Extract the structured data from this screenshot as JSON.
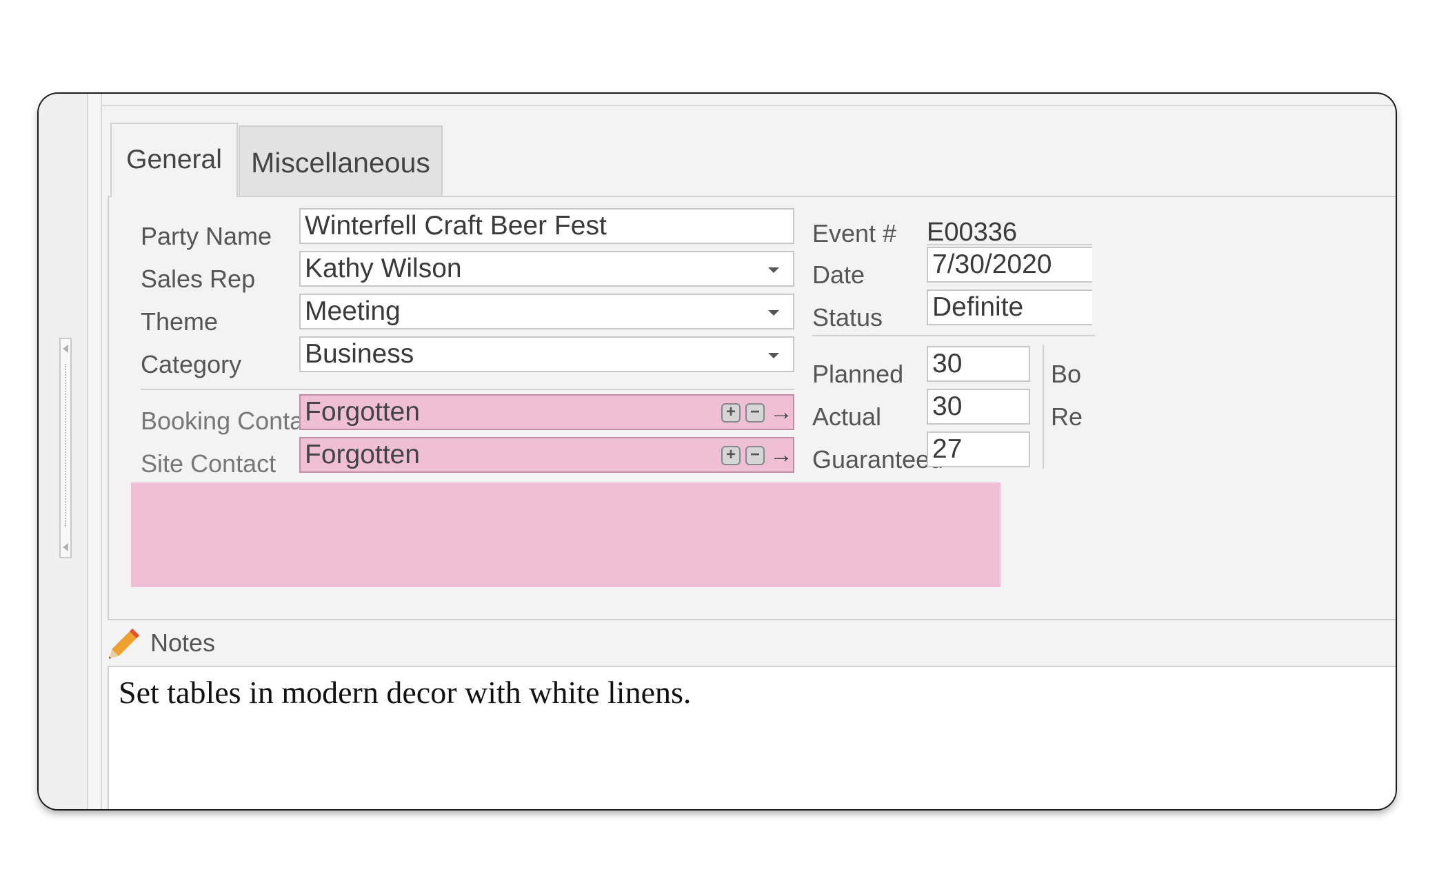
{
  "tabs": [
    {
      "label": "General",
      "active": true
    },
    {
      "label": "Miscellaneous",
      "active": false
    }
  ],
  "form": {
    "party_name": {
      "label": "Party Name",
      "value": "Winterfell Craft Beer Fest"
    },
    "sales_rep": {
      "label": "Sales Rep",
      "value": "Kathy Wilson"
    },
    "theme": {
      "label": "Theme",
      "value": "Meeting"
    },
    "category": {
      "label": "Category",
      "value": "Business"
    },
    "booking_contact": {
      "label": "Booking Contact",
      "value": "Forgotten"
    },
    "site_contact": {
      "label": "Site Contact",
      "value": "Forgotten"
    }
  },
  "event": {
    "event_no": {
      "label": "Event #",
      "value": "E00336"
    },
    "date": {
      "label": "Date",
      "value": "7/30/2020"
    },
    "status": {
      "label": "Status",
      "value": "Definite"
    },
    "planned": {
      "label": "Planned",
      "value": "30"
    },
    "actual": {
      "label": "Actual",
      "value": "30"
    },
    "guaranteed": {
      "label": "Guaranteed",
      "value": "27"
    },
    "cut_labels": [
      "Bo",
      "Re"
    ]
  },
  "notes": {
    "label": "Notes",
    "text": "Set tables in modern decor with white linens."
  },
  "colors": {
    "highlight": "#efbfd4",
    "pencil": "#f0a030"
  },
  "icons": [
    "pencil-icon",
    "add-icon",
    "remove-icon",
    "arrow-right-icon",
    "chevron-down-icon"
  ]
}
